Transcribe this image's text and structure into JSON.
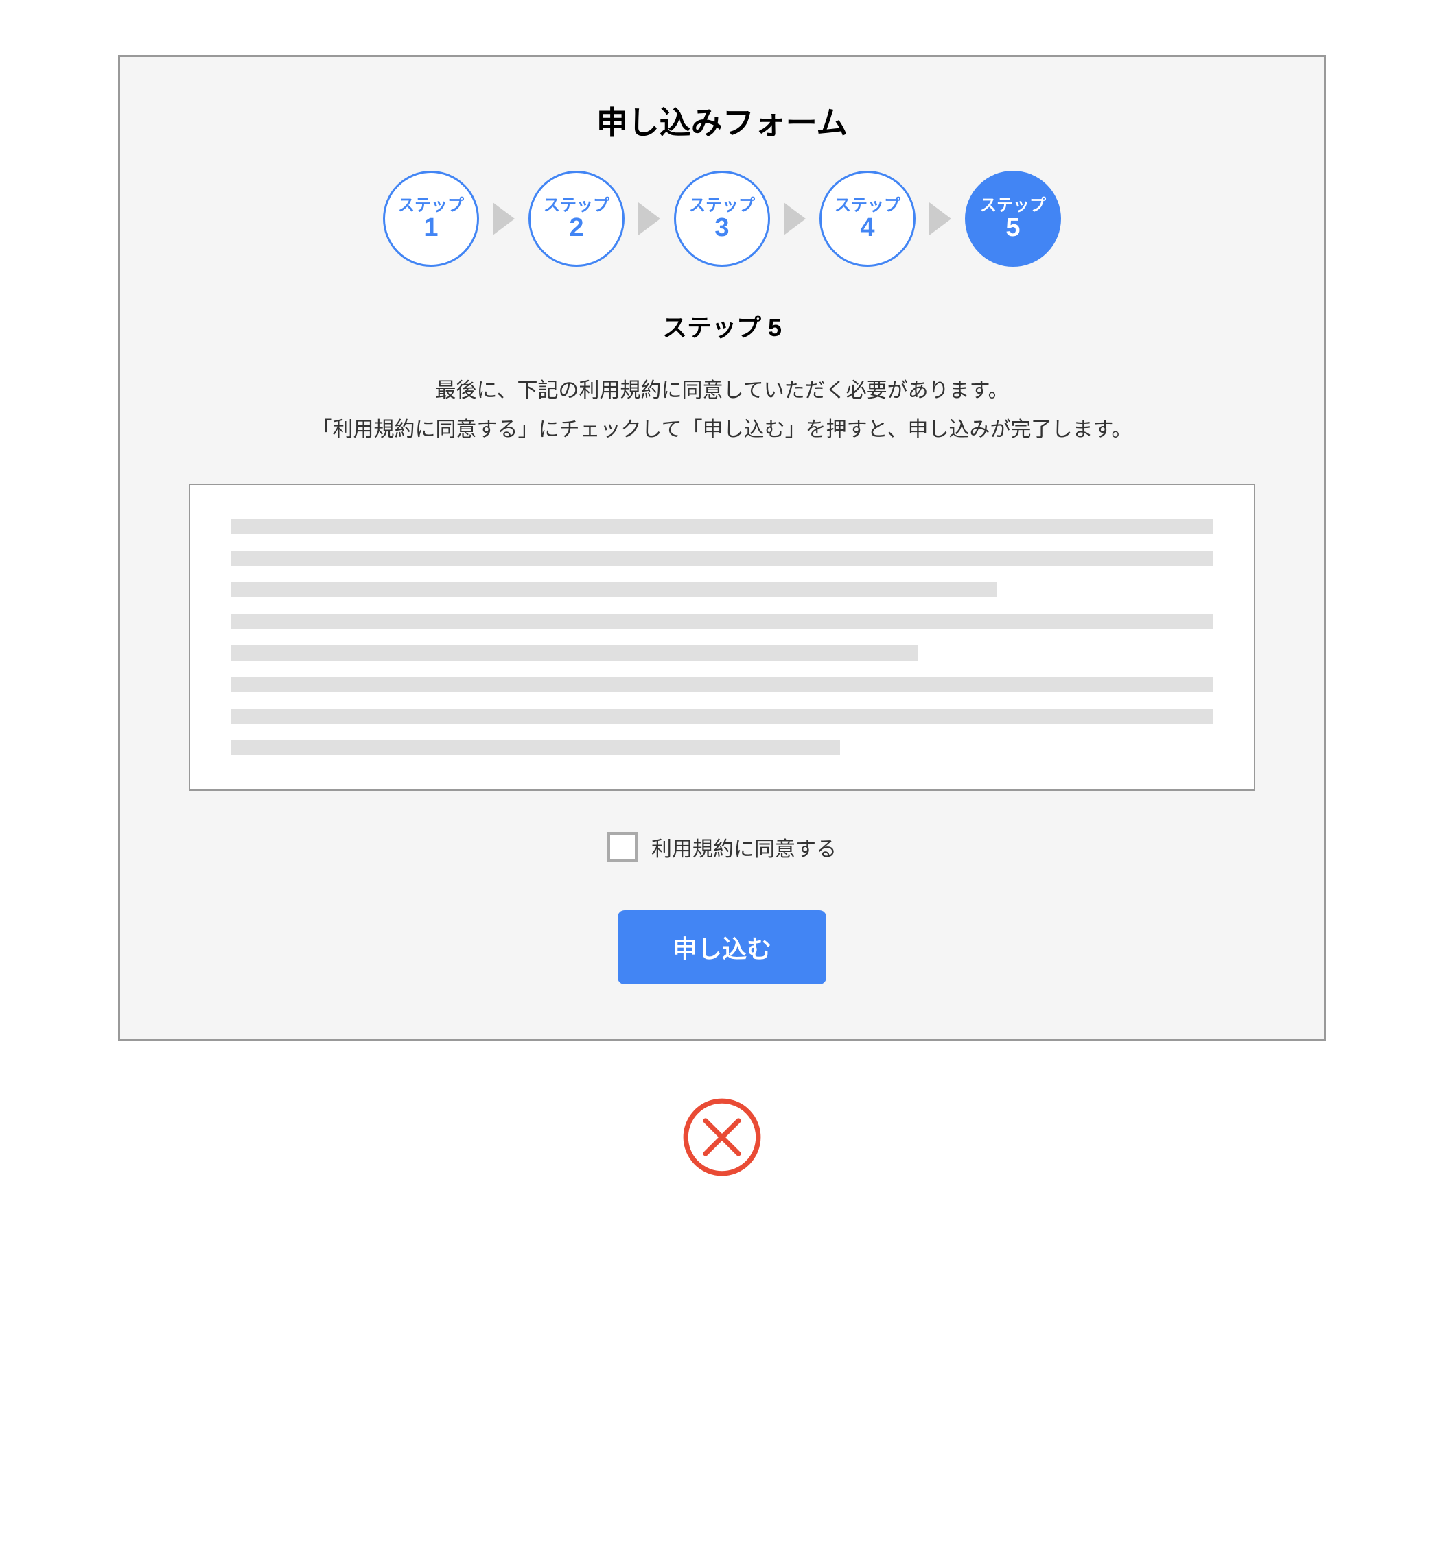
{
  "form": {
    "title": "申し込みフォーム",
    "steps": [
      {
        "label": "ステップ",
        "number": "1",
        "active": false
      },
      {
        "label": "ステップ",
        "number": "2",
        "active": false
      },
      {
        "label": "ステップ",
        "number": "3",
        "active": false
      },
      {
        "label": "ステップ",
        "number": "4",
        "active": false
      },
      {
        "label": "ステップ",
        "number": "5",
        "active": true
      }
    ],
    "current_step_heading": "ステップ 5",
    "instruction_line1": "最後に、下記の利用規約に同意していただく必要があります。",
    "instruction_line2": "「利用規約に同意する」にチェックして「申し込む」を押すと、申し込みが完了します。",
    "checkbox_label": "利用規約に同意する",
    "checkbox_checked": false,
    "submit_label": "申し込む"
  },
  "colors": {
    "primary": "#4285f4",
    "reject": "#e94b35",
    "border": "#999999",
    "bg_panel": "#f5f5f5"
  }
}
